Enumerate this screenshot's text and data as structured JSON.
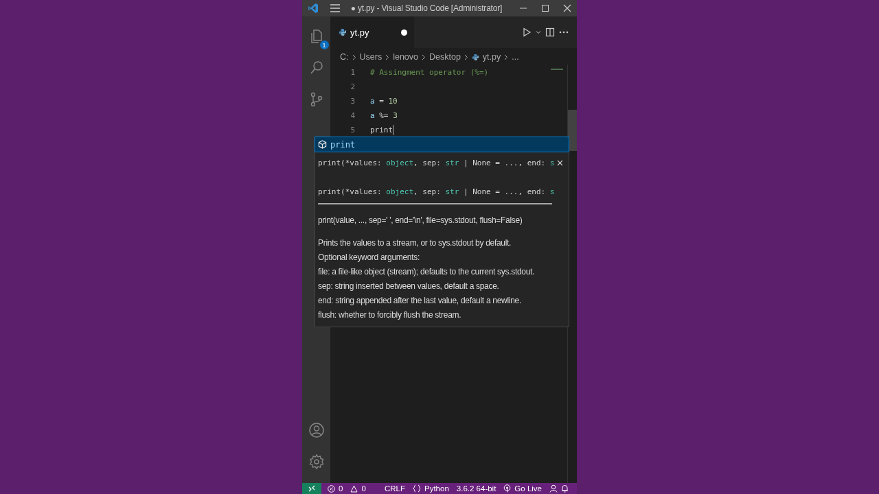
{
  "window": {
    "title": "● yt.py - Visual Studio Code [Administrator]"
  },
  "activity_bar": {
    "explorer_badge": "1"
  },
  "tabs": [
    {
      "label": "yt.py",
      "selected": true,
      "modified": true
    }
  ],
  "breadcrumbs": [
    {
      "label": "C:",
      "kind": "folder"
    },
    {
      "label": "Users",
      "kind": "folder"
    },
    {
      "label": "lenovo",
      "kind": "folder"
    },
    {
      "label": "Desktop",
      "kind": "folder"
    },
    {
      "label": "yt.py",
      "kind": "file"
    },
    {
      "label": "...",
      "kind": "more"
    }
  ],
  "code_lines": [
    {
      "number": "1",
      "tokens": [
        {
          "text": "# Assingment operator (%=)",
          "kind": "comment"
        }
      ]
    },
    {
      "number": "2"
    },
    {
      "number": "3",
      "tokens": [
        {
          "text": "a",
          "kind": "variable"
        },
        {
          "text": " = ",
          "kind": "plain"
        },
        {
          "text": "10",
          "kind": "number"
        }
      ]
    },
    {
      "number": "4",
      "tokens": [
        {
          "text": "a",
          "kind": "variable"
        },
        {
          "text": " %= ",
          "kind": "plain"
        },
        {
          "text": "3",
          "kind": "number"
        }
      ]
    },
    {
      "number": "5",
      "tokens": [
        {
          "text": "print",
          "kind": "plain"
        }
      ],
      "cursor": true
    }
  ],
  "suggest": {
    "items": [
      {
        "label": "print",
        "selected": true
      }
    ],
    "signatures": [
      {
        "tokens": [
          {
            "text": "print(*values: ",
            "kind": "plain"
          },
          {
            "text": "object",
            "kind": "type"
          },
          {
            "text": ", sep: ",
            "kind": "plain"
          },
          {
            "text": "str",
            "kind": "type"
          },
          {
            "text": " | None = ..., end: ",
            "kind": "plain"
          },
          {
            "text": "s",
            "kind": "type"
          }
        ]
      },
      {
        "tokens": [
          {
            "text": "print(*values: ",
            "kind": "plain"
          },
          {
            "text": "object",
            "kind": "type"
          },
          {
            "text": ", sep: ",
            "kind": "plain"
          },
          {
            "text": "str",
            "kind": "type"
          },
          {
            "text": " | None = ..., end: ",
            "kind": "plain"
          },
          {
            "text": "s",
            "kind": "type"
          }
        ]
      }
    ],
    "doc_signature": "print(value, ..., sep=' ', end='\\n', file=sys.stdout, flush=False)",
    "doc_lines": [
      "Prints the values to a stream, or to sys.stdout by default.",
      "Optional keyword arguments:",
      "file: a file-like object (stream); defaults to the current sys.stdout.",
      "sep: string inserted between values, default a space.",
      "end: string appended after the last value, default a newline.",
      "flush: whether to forcibly flush the stream."
    ]
  },
  "status_bar": {
    "errors": "0",
    "warnings": "0",
    "line_ending": "CRLF",
    "language": "Python",
    "interpreter": "3.6.2 64-bit",
    "go_live": "Go Live"
  }
}
